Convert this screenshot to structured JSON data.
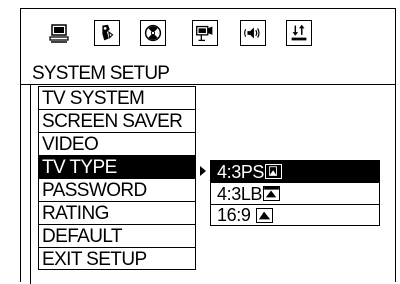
{
  "toolbar": {
    "icons": [
      {
        "name": "general-setup-icon",
        "boxed": false
      },
      {
        "name": "speaker-setup-icon",
        "boxed": true
      },
      {
        "name": "dolby-setup-icon",
        "boxed": true
      },
      {
        "name": "video-setup-icon",
        "boxed": true
      },
      {
        "name": "audio-setup-icon",
        "boxed": true
      },
      {
        "name": "preference-setup-icon",
        "boxed": true
      }
    ]
  },
  "title": "SYSTEM SETUP",
  "menu": {
    "items": [
      {
        "label": "TV SYSTEM",
        "active": false
      },
      {
        "label": "SCREEN SAVER",
        "active": false
      },
      {
        "label": "VIDEO",
        "active": false
      },
      {
        "label": "TV TYPE",
        "active": true
      },
      {
        "label": "PASSWORD",
        "active": false
      },
      {
        "label": "RATING",
        "active": false
      },
      {
        "label": "DEFAULT",
        "active": false
      },
      {
        "label": "EXIT SETUP",
        "active": false
      }
    ]
  },
  "submenu": {
    "items": [
      {
        "label": "4:3PS",
        "icon": "pan-scan-icon",
        "active": true
      },
      {
        "label": "4:3LB",
        "icon": "letterbox-icon",
        "active": false
      },
      {
        "label": "16:9",
        "icon": "widescreen-icon",
        "active": false
      }
    ]
  }
}
